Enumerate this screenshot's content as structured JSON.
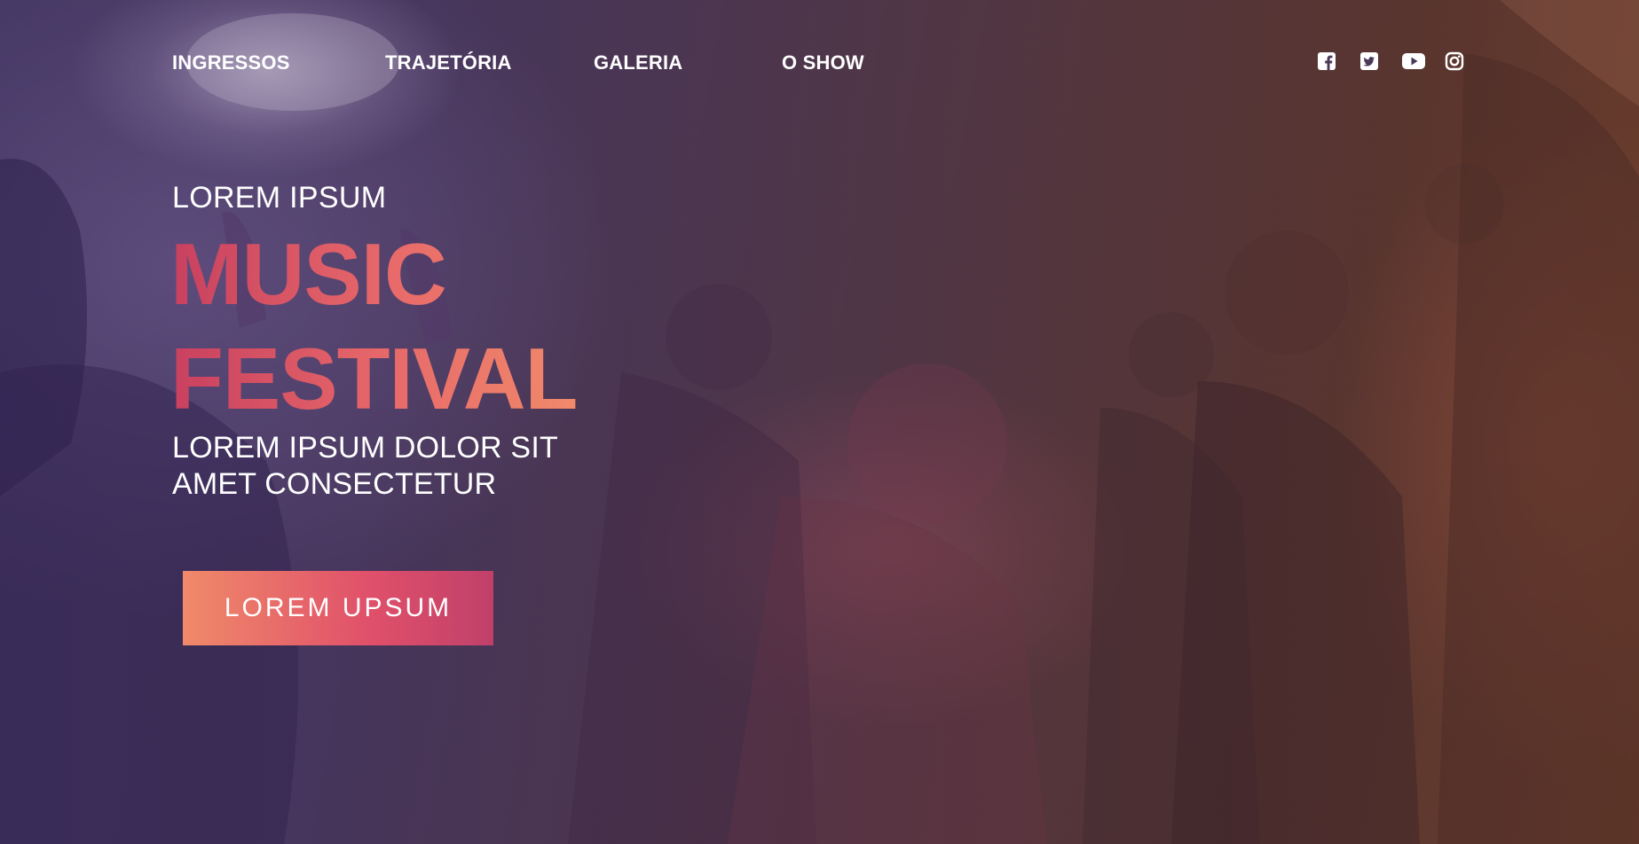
{
  "nav": {
    "items": [
      {
        "label": "INGRESSOS"
      },
      {
        "label": "TRAJETÓRIA"
      },
      {
        "label": "GALERIA"
      },
      {
        "label": "O SHOW"
      }
    ]
  },
  "social": {
    "icons": [
      "facebook-icon",
      "twitter-icon",
      "youtube-icon",
      "instagram-icon"
    ]
  },
  "hero": {
    "kicker": "LOREM IPSUM",
    "title_line1": "MUSIC",
    "title_line2": "FESTIVAL",
    "subtitle_line1": "LOREM IPSUM DOLOR SIT",
    "subtitle_line2": "AMET CONSECTETUR",
    "cta_label": "LOREM UPSUM"
  },
  "colors": {
    "accent_start": "#c8405f",
    "accent_end": "#f08a6a",
    "text": "#ffffff"
  }
}
